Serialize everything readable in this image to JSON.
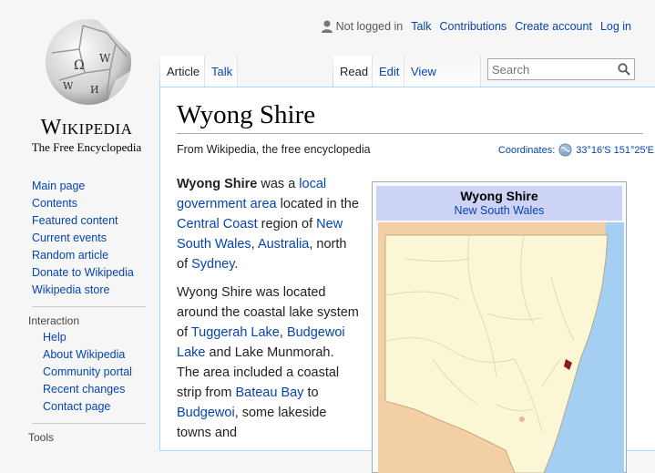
{
  "logo": {
    "wordmark": "Wikipedia",
    "tagline": "The Free Encyclopedia"
  },
  "personal": {
    "status": "Not logged in",
    "links": [
      "Talk",
      "Contributions",
      "Create account",
      "Log in"
    ]
  },
  "tabs": {
    "left": [
      "Article",
      "Talk"
    ],
    "right": [
      "Read",
      "Edit",
      "View history"
    ]
  },
  "search": {
    "placeholder": "Search"
  },
  "sidebar": {
    "main": [
      "Main page",
      "Contents",
      "Featured content",
      "Current events",
      "Random article",
      "Donate to Wikipedia",
      "Wikipedia store"
    ],
    "interaction_heading": "Interaction",
    "interaction": [
      "Help",
      "About Wikipedia",
      "Community portal",
      "Recent changes",
      "Contact page"
    ],
    "tools_heading": "Tools"
  },
  "article": {
    "title": "Wyong Shire",
    "tagline": "From Wikipedia, the free encyclopedia",
    "coords_label": "Coordinates:",
    "coords_value": "33°16′S 151°25′E",
    "p1": {
      "bold": "Wyong Shire",
      "t1": " was a ",
      "l1": "local government area",
      "t2": " located in the ",
      "l2": "Central Coast",
      "t3": " region of ",
      "l3": "New South Wales",
      "t4": ", ",
      "l4": "Australia",
      "t5": ", north of ",
      "l5": "Sydney",
      "t6": "."
    },
    "p2": {
      "t1": "Wyong Shire was located around the coastal lake system of ",
      "l1": "Tuggerah Lake",
      "t2": ", ",
      "l2": "Budgewoi Lake",
      "t3": " and Lake Munmorah. The area included a coastal strip from ",
      "l3": "Bateau Bay",
      "t4": " to ",
      "l4": "Budgewoi",
      "t5": ", some lakeside towns and"
    }
  },
  "infobox": {
    "title": "Wyong Shire",
    "subtitle": "New South Wales"
  },
  "colors": {
    "link": "#0645ad",
    "infobox_header": "#ccd3f5",
    "map_land": "#fbf7d6",
    "map_sea": "#a4cff2",
    "map_outside": "#f3cfa6",
    "marker": "#8b1a1a"
  }
}
